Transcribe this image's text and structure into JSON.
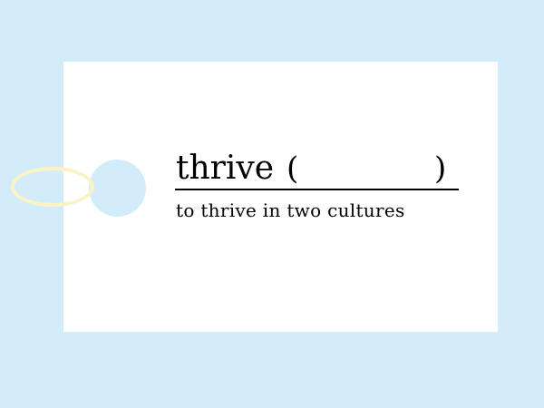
{
  "card": {
    "word": "thrive",
    "paren_open": "(",
    "paren_close": ")",
    "blank_value": "",
    "example_phrase": "to thrive in two cultures"
  },
  "colors": {
    "background": "#d3ecf9",
    "card": "#ffffff",
    "string": "#fbf3c6",
    "text": "#000000"
  }
}
